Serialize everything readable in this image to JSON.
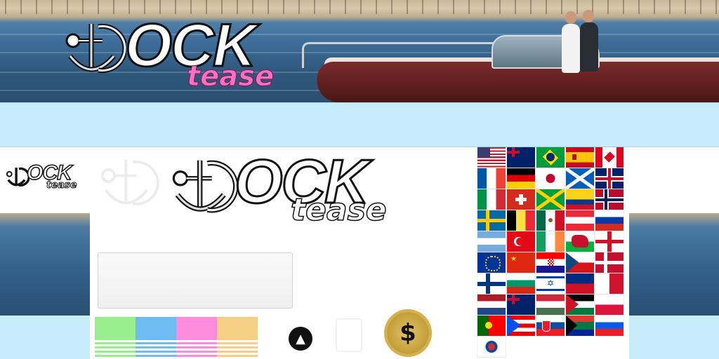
{
  "banner": {
    "logo_word": "OCK",
    "logo_sub": "tease"
  },
  "main_logo": {
    "word": "OCK",
    "sub": "tease"
  },
  "small_logo": {
    "word": "OCK",
    "sub": "tease"
  },
  "color_swatches": [
    {
      "name": "green",
      "color": "#98ee8c"
    },
    {
      "name": "blue",
      "color": "#6ebcf2"
    },
    {
      "name": "pink",
      "color": "#ff8bdc"
    },
    {
      "name": "gold",
      "color": "#f5cf84"
    }
  ],
  "icons": {
    "shirt": "t-shirt-plus-icon",
    "money": "dollar-coin-icon",
    "money_symbol": "$"
  },
  "flags": [
    "us",
    "au",
    "br",
    "es",
    "ca",
    "fr",
    "de",
    "jp",
    "scotland",
    "gb",
    "it",
    "ch",
    "jm",
    "co",
    "no",
    "se",
    "be",
    "mx",
    "at",
    "ru",
    "ar",
    "tr",
    "ie",
    "wales",
    "england",
    "eu",
    "cn",
    "hr",
    "cz",
    "dk",
    "fi",
    "bg",
    "il",
    "li",
    "mt",
    "nl",
    "nz",
    "hu",
    "ps",
    "pl",
    "pt",
    "pr",
    "sk",
    "za",
    "si",
    "kr"
  ]
}
